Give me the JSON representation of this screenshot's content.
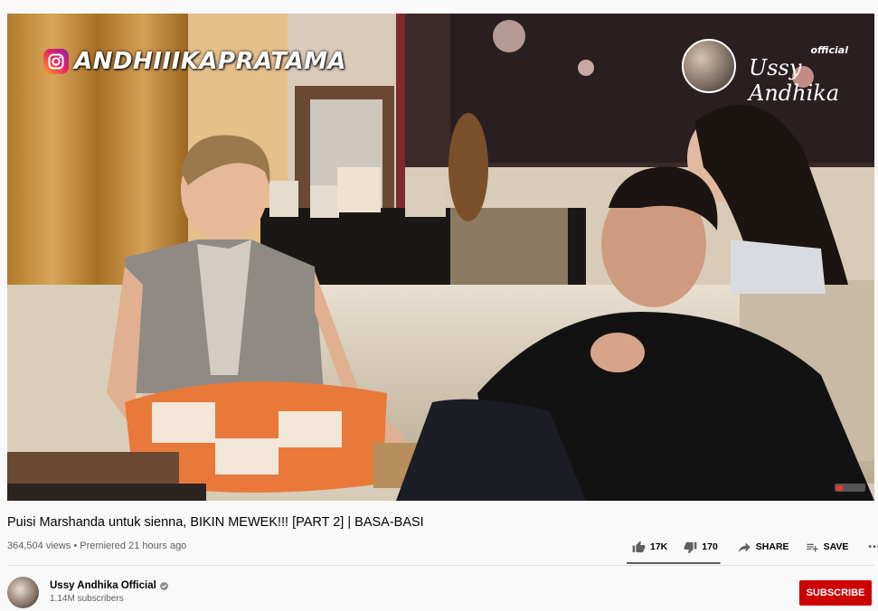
{
  "video": {
    "watermark_left": "ANDHIIIKAPRATAMA",
    "watermark_right_tag": "official",
    "watermark_right_name": "Ussy Andhika"
  },
  "details": {
    "title": "Puisi Marshanda untuk sienna, BIKIN MEWEK!!! [PART 2] | BASA-BASI",
    "views_line": "364,504 views • Premiered 21 hours ago",
    "likes": "17K",
    "dislikes": "170",
    "share_label": "SHARE",
    "save_label": "SAVE",
    "more_label": "•••",
    "like_ratio": 0.99
  },
  "channel": {
    "name": "Ussy Andhika Official",
    "subscribers": "1.14M subscribers",
    "subscribe_label": "SUBSCRIBE"
  },
  "colors": {
    "subscribe_bg": "#cc0000",
    "page_bg": "#f9f9f9"
  }
}
